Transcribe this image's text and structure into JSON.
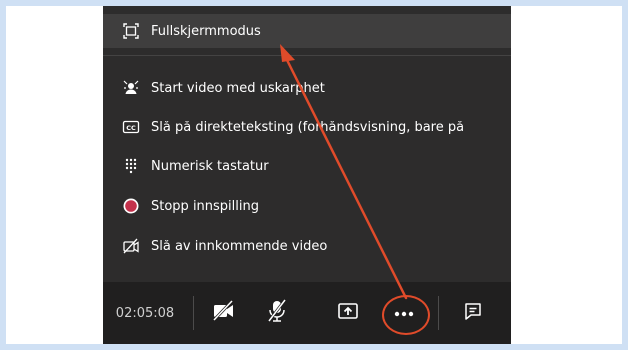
{
  "menu": {
    "items": [
      {
        "label": "Fullskjermmodus",
        "icon": "fullscreen-icon"
      },
      {
        "label": "Start video med uskarphet",
        "icon": "blur-background-icon"
      },
      {
        "label": "Slå på direkteteksting (forhåndsvisning, bare på",
        "icon": "closed-captions-icon"
      },
      {
        "label": "Numerisk tastatur",
        "icon": "dialpad-icon"
      },
      {
        "label": "Stopp innspilling",
        "icon": "record-stop-icon"
      },
      {
        "label": "Slå av innkommende video",
        "icon": "incoming-video-off-icon"
      }
    ]
  },
  "toolbar": {
    "timer": "02:05:08",
    "buttons": [
      {
        "name": "camera-off-button",
        "icon": "camera-off-icon"
      },
      {
        "name": "microphone-off-button",
        "icon": "microphone-off-icon"
      },
      {
        "name": "share-screen-button",
        "icon": "share-icon"
      },
      {
        "name": "more-actions-button",
        "icon": "more-icon"
      },
      {
        "name": "chat-button",
        "icon": "chat-icon"
      }
    ]
  },
  "annotation": {
    "color": "#e04b2a"
  },
  "colors": {
    "frame": "#cfe0f4",
    "menu_background": "#2d2c2c",
    "toolbar_background": "#201f1f",
    "record_red": "#c4314b"
  }
}
